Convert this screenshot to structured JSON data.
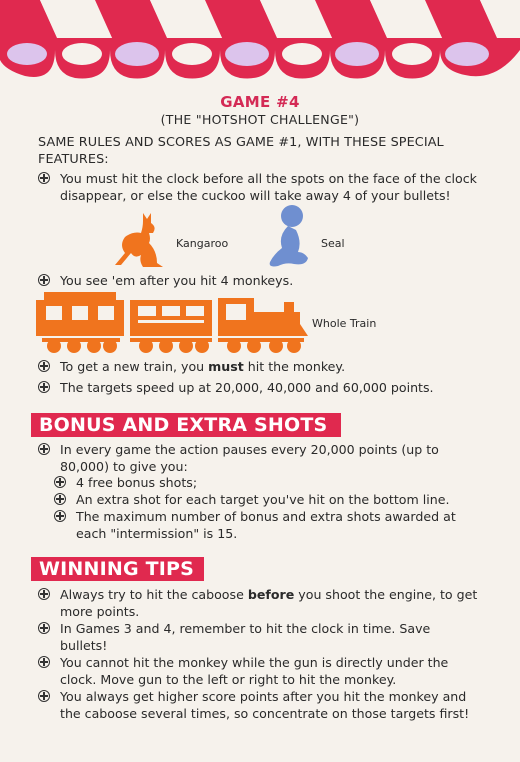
{
  "game": {
    "title": "GAME #4",
    "subtitle": "(THE \"HOTSHOT CHALLENGE\")",
    "intro": "SAME RULES AND SCORES AS GAME #1, WITH THESE SPECIAL FEATURES:",
    "bullet1": "You must hit the clock before all the spots on the face of the clock disappear, or else the cuckoo will take away 4 of your bullets!",
    "kangaroo_label": "Kangaroo",
    "seal_label": "Seal",
    "bullet2": "You see 'em after you hit 4 monkeys.",
    "train_label": "Whole Train",
    "bullet3_pre": "To get a new train, you ",
    "bullet3_bold": "must",
    "bullet3_post": " hit the monkey.",
    "bullet4": "The targets speed up at 20,000, 40,000 and 60,000 points."
  },
  "bonus": {
    "heading": "BONUS AND EXTRA SHOTS",
    "bullet1": "In every game the action pauses every 20,000 points (up to 80,000) to give you:",
    "sub1": "4 free bonus shots;",
    "sub2": "An extra shot for each target you've hit on the bottom line.",
    "sub3": "The maximum number of bonus and extra shots awarded at each \"intermission\" is 15."
  },
  "tips": {
    "heading": "WINNING TIPS",
    "tip1_pre": "Always try to hit the caboose ",
    "tip1_bold": "before",
    "tip1_post": " you shoot the engine, to get more points.",
    "tip2": "In Games 3 and 4, remember to hit the clock in time. Save bullets!",
    "tip3": "You cannot hit the monkey while the gun is directly under the clock. Move gun to the left or right to hit the monkey.",
    "tip4": "You always get higher score points after you hit the monkey and the caboose several times, so concentrate on those targets first!"
  },
  "colors": {
    "red": "#e0294f",
    "orange": "#f0741e",
    "blue": "#6f8fd0",
    "lavender": "#dcc4ec"
  }
}
